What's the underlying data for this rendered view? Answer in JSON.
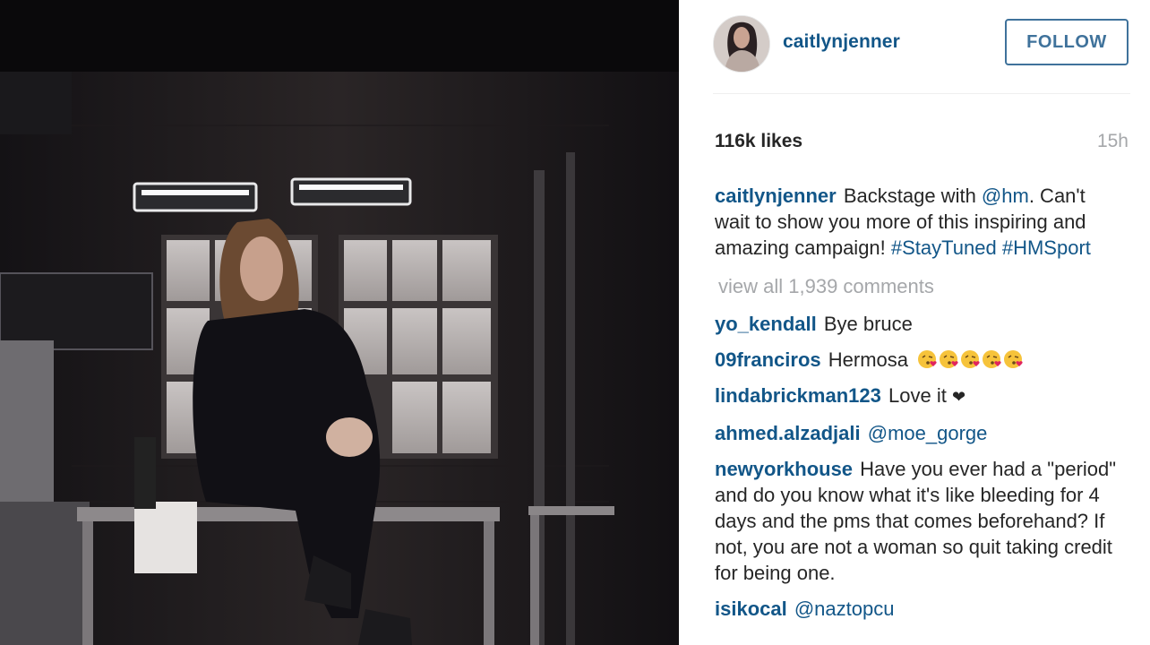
{
  "post": {
    "username": "caitlynjenner",
    "follow_label": "FOLLOW",
    "likes": "116k likes",
    "time_ago": "15h",
    "caption": {
      "user": "caitlynjenner",
      "text_1": "Backstage with ",
      "mention": "@hm",
      "text_2": ". Can't wait to show you more of this inspiring and amazing campaign! ",
      "hashtag_1": "#StayTuned",
      "hashtag_2": "#HMSport"
    },
    "view_all": "view all 1,939 comments"
  },
  "comments": [
    {
      "user": "yo_kendall",
      "text": "Bye bruce"
    },
    {
      "user": "09franciros",
      "text": "Hermosa",
      "emoji": "kissing-face-emoji",
      "emoji_count": 5
    },
    {
      "user": "lindabrickman123",
      "text": "Love it",
      "icon": "heart-icon"
    },
    {
      "user": "ahmed.alzadjali",
      "mention": "@moe_gorge"
    },
    {
      "user": "newyorkhouse",
      "text": "Have you ever had a \"period\" and do you know what it's like bleeding for 4 days and the pms that comes beforehand? If not, you are not a woman so quit taking credit for being one."
    },
    {
      "user": "isikocal",
      "mention": "@naztopcu"
    }
  ],
  "colors": {
    "link": "#125688",
    "follow_border": "#3f729b",
    "muted": "#a5a7aa",
    "text": "#262626"
  },
  "icons": {
    "heart": "❤"
  }
}
